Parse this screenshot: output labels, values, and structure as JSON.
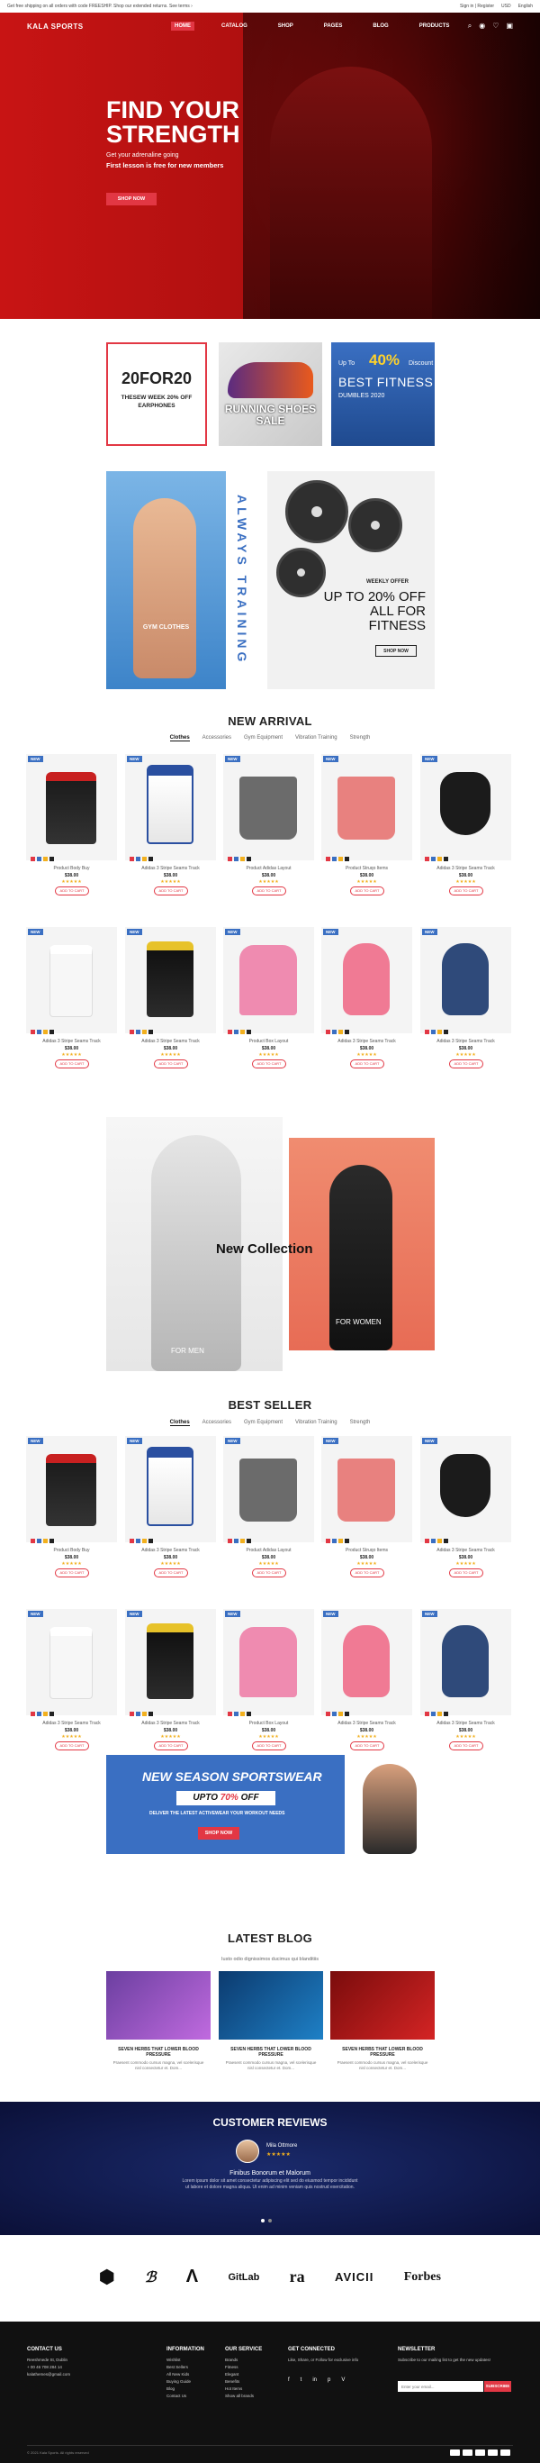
{
  "topbar": {
    "left": "Get free shipping on all orders with code FREESHIP. Shop our extended returns. See terms ›",
    "login": "Sign in | Register",
    "lang": "USD",
    "lang2": "English"
  },
  "nav": {
    "logo": "KALA SPORTS",
    "items": [
      "HOME",
      "CATALOG",
      "SHOP",
      "PAGES",
      "BLOG",
      "PRODUCTS"
    ]
  },
  "hero": {
    "title1": "FIND YOUR",
    "title2": "STRENGTH",
    "sub": "Get your adrenaline going",
    "sub2": "First lesson is free for new members",
    "cta": "SHOP NOW"
  },
  "promos": {
    "p1_title": "20FOR20",
    "p1_sub": "THESEW WEEK 20% OFF EARPHONES",
    "p2_title": "RUNNING SHOES SALE",
    "p3_a": "Up To",
    "p3_big": "40%",
    "p3_b": "Discount",
    "p3_c": "BEST FITNESS",
    "p3_d": "DUMBLES 2020"
  },
  "banners": {
    "left_label": "GYM CLOTHES",
    "vertical": "ALWAYS TRAINING",
    "offer_small": "WEEKLY OFFER",
    "offer_big": "UP TO 20% OFF ALL FOR FITNESS",
    "shop": "SHOP NOW"
  },
  "new_arrival": {
    "title": "NEW ARRIVAL",
    "tabs": [
      "Clothes",
      "Accessories",
      "Gym Equipment",
      "Vibration Training",
      "Strength"
    ]
  },
  "best_seller": {
    "title": "BEST SELLER",
    "tabs": [
      "Clothes",
      "Accessories",
      "Gym Equipment",
      "Vibration Training",
      "Strength"
    ]
  },
  "products": [
    {
      "name": "Product Body Buy",
      "price": "$38.00",
      "badge": "NEW"
    },
    {
      "name": "Adidas 3 Stripe Seams Track",
      "price": "$38.00",
      "badge": "NEW"
    },
    {
      "name": "Product Adidas Layout",
      "price": "$38.00",
      "badge": "NEW"
    },
    {
      "name": "Product Struqo Items",
      "price": "$38.00",
      "badge": "NEW"
    },
    {
      "name": "Adidas 3 Stripe Seams Track",
      "price": "$38.00",
      "badge": "NEW"
    },
    {
      "name": "Adidas 3 Stripe Seams Track",
      "price": "$38.00",
      "badge": "NEW"
    },
    {
      "name": "Adidas 3 Stripe Seams Track",
      "price": "$38.00",
      "badge": "NEW"
    },
    {
      "name": "Product Box Layout",
      "price": "$38.00",
      "badge": "NEW"
    },
    {
      "name": "Adidas 3 Stripe Seams Track",
      "price": "$38.00",
      "badge": "NEW"
    },
    {
      "name": "Adidas 3 Stripe Seams Track",
      "price": "$38.00",
      "badge": "NEW"
    }
  ],
  "card": {
    "add": "ADD TO CART",
    "stars": "★★★★★"
  },
  "new_collection": {
    "title": "New Collection",
    "men": "FOR MEN",
    "women": "FOR WOMEN"
  },
  "season": {
    "title": "NEW SEASON SPORTSWEAR",
    "upto": "UPTO",
    "pct": "70%",
    "off": "OFF",
    "sub": "DELIVER THE LATEST ACTIVEWEAR YOUR WORKOUT NEEDS",
    "cta": "SHOP NOW"
  },
  "blog": {
    "title": "LATEST BLOG",
    "sub": "Iusto odio dignissimos ducimus qui blanditiis",
    "posts": [
      {
        "title": "SEVEN HERBS THAT LOWER BLOOD PRESSURE",
        "desc": "Praesent commodo cursus magna, vel scelerisque nisl consectetur et. Dom..."
      },
      {
        "title": "SEVEN HERBS THAT LOWER BLOOD PRESSURE",
        "desc": "Praesent commodo cursus magna, vel scelerisque nisl consectetur et. Dom..."
      },
      {
        "title": "SEVEN HERBS THAT LOWER BLOOD PRESSURE",
        "desc": "Praesent commodo cursus magna, vel scelerisque nisl consectetur et. Dom..."
      }
    ]
  },
  "reviews": {
    "title": "CUSTOMER REVIEWS",
    "name": "Mila Ottmore",
    "stars": "★★★★★",
    "headline": "Finibus Bonorum et Malorum",
    "body": "Lorem ipsum dolor sit amet consectetur adipiscing elit sed do eiusmod tempor incididunt ut labore et dolore magna aliqua. Ut enim ad minim veniam quis nostrud exercitation."
  },
  "brands": [
    "GitLab",
    "ra",
    "AVICII",
    "Forbes"
  ],
  "footer": {
    "contact": {
      "title": "CONTACT US",
      "lines": [
        "Reeshmede St, Dublin",
        "+ 00 46 708 284 14",
        "kalathemes@gmail.com"
      ]
    },
    "info": {
      "title": "INFORMATION",
      "lines": [
        "Wishlist",
        "Best Sellers",
        "All New Kids",
        "Buying Guide",
        "Blog",
        "Contact Us"
      ]
    },
    "service": {
      "title": "OUR SERVICE",
      "lines": [
        "Brands",
        "Fitness",
        "Elegant",
        "Benefits",
        "Hot Items",
        "Show all brands"
      ]
    },
    "connected": {
      "title": "GET CONNECTED",
      "text": "Like, Share, or Follow for exclusive info",
      "icons": [
        "f",
        "t",
        "in",
        "p",
        "V"
      ]
    },
    "newsletter": {
      "title": "NEWSLETTER",
      "text": "Subscribe to our mailing list to get the new updates!",
      "placeholder": "Enter your email...",
      "button": "SUBSCRIBE"
    },
    "copy": "© 2021 Kala Sports. All rights reserved"
  },
  "colors": {
    "accent": "#e23744",
    "blue": "#3a6fc2",
    "navy": "#0b1038"
  }
}
